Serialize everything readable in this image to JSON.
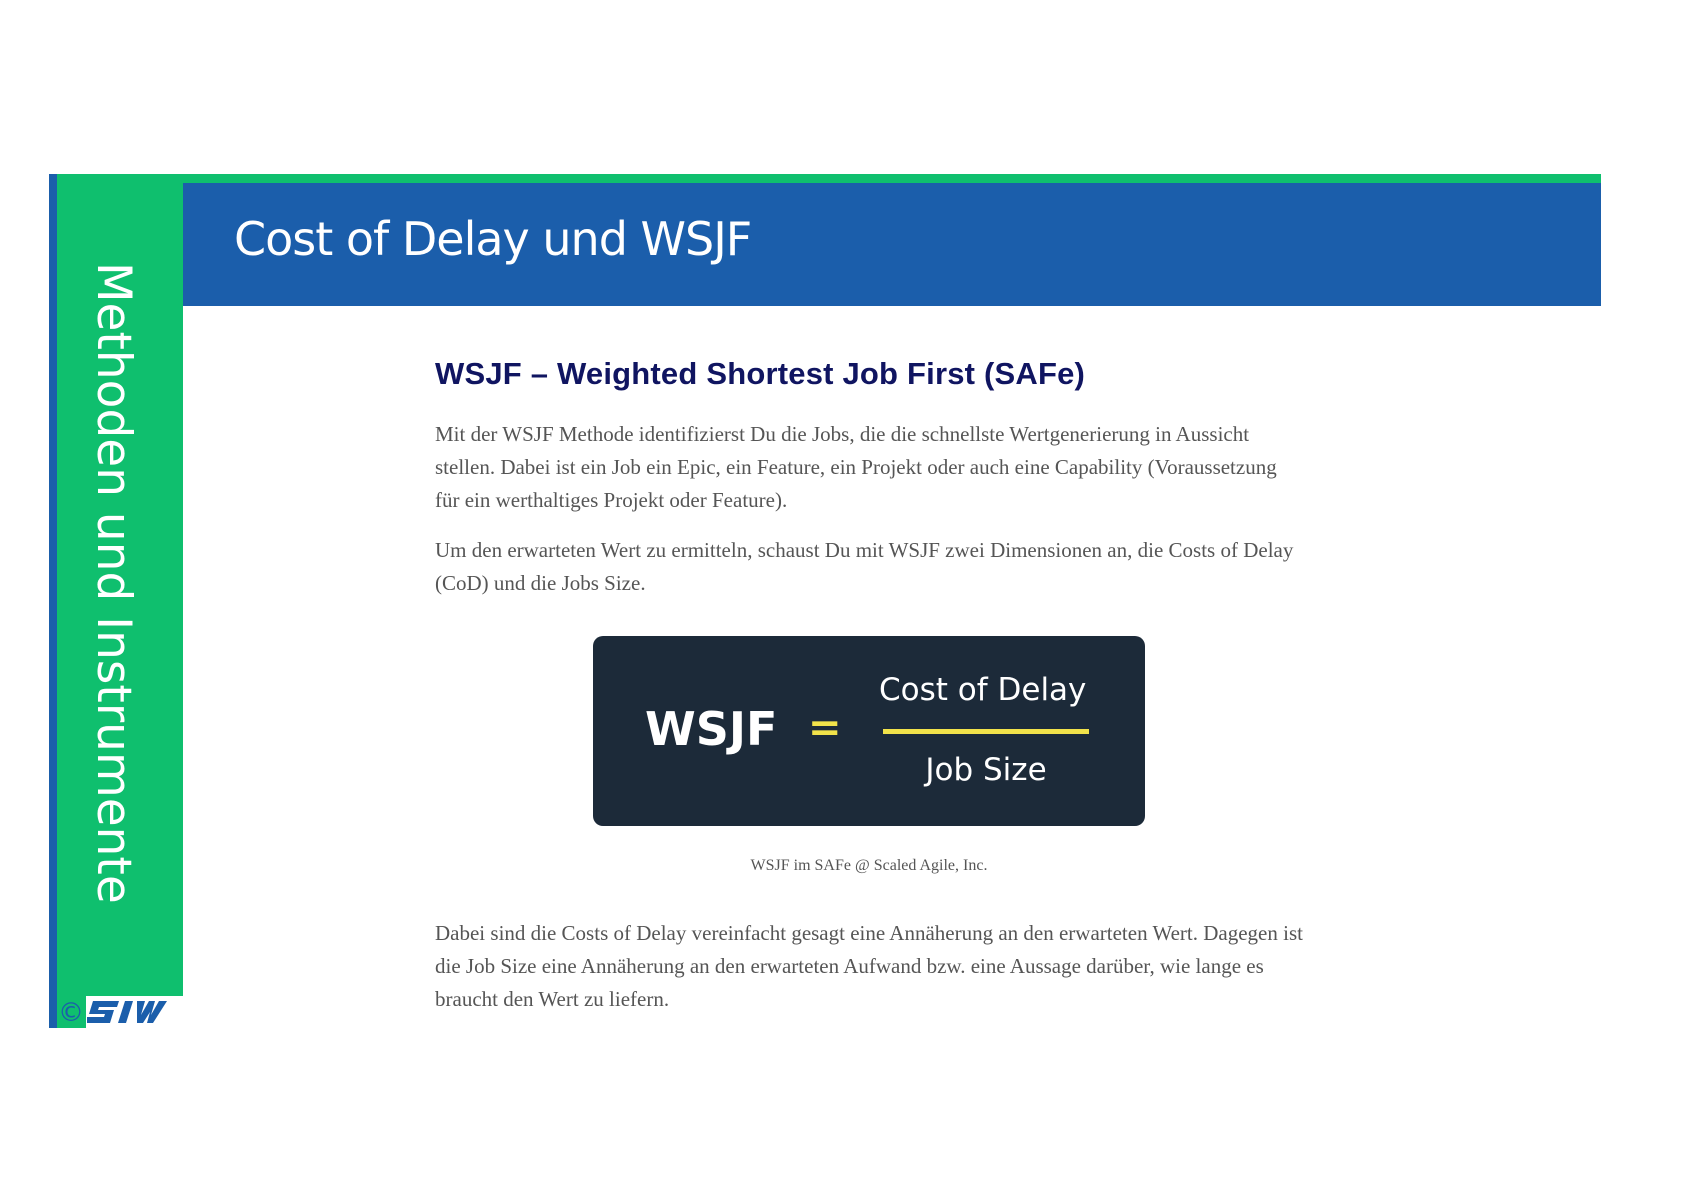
{
  "sidebar": {
    "title": "Methoden und Instrumente",
    "logo_text": "©"
  },
  "header": {
    "title": "Cost of Delay und WSJF"
  },
  "content": {
    "heading": "WSJF  – Weighted Shortest Job First (SAFe)",
    "paragraph_1": "Mit der WSJF Methode identifizierst Du die Jobs, die die schnellste Wertgenerierung in Aussicht stellen. Dabei ist ein Job ein Epic, ein Feature, ein Projekt oder auch eine Capability (Voraussetzung für ein werthaltiges Projekt oder Feature).",
    "paragraph_2": "Um den erwarteten Wert zu ermitteln, schaust Du mit WSJF zwei Dimensionen an, die Costs of Delay (CoD) und die Jobs Size.",
    "formula": {
      "left": "WSJF",
      "equals": "=",
      "numerator": "Cost of Delay",
      "denominator": "Job Size"
    },
    "caption": "WSJF im SAFe @ Scaled Agile, Inc.",
    "paragraph_3": "Dabei sind die Costs of Delay vereinfacht gesagt eine Annäherung an den erwarteten Wert. Dagegen ist die Job Size eine Annäherung an den erwarteten Aufwand bzw. eine Aussage darüber, wie lange es braucht den Wert zu liefern."
  },
  "colors": {
    "header_blue": "#1b5eab",
    "band_green": "#0fbf6e",
    "heading_navy": "#101561",
    "formula_bg": "#1c2a39",
    "formula_accent": "#f1e24a"
  }
}
